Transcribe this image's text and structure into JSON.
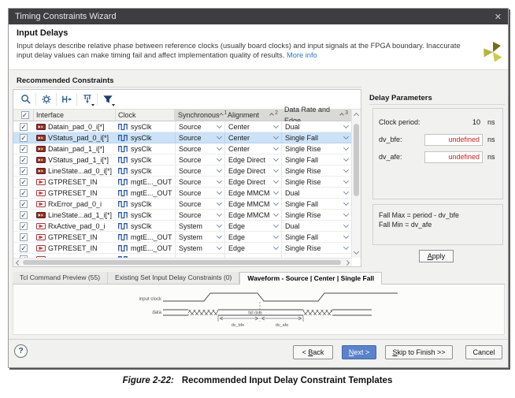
{
  "window": {
    "title": "Timing Constraints Wizard"
  },
  "glyphs": {
    "close": "✕",
    "check": "✓",
    "help": "?"
  },
  "header": {
    "title": "Input Delays",
    "description": "Input delays describe relative phase between reference clocks (usually board clocks) and input signals at the FPGA boundary. Inaccurate input delay values can make timing fail and affect implementation quality of results. ",
    "more_info": "More info"
  },
  "constraints": {
    "section_title": "Recommended Constraints",
    "toolbar_icons": [
      "search-icon",
      "settings-icon",
      "fit-to-selection-icon",
      "group-options-icon",
      "filter-icon"
    ],
    "table": {
      "columns": [
        {
          "label": "Interface"
        },
        {
          "label": "Clock"
        },
        {
          "label": "Synchronous",
          "sort": "1"
        },
        {
          "label": "Alignment",
          "sort": "2"
        },
        {
          "label": "Data Rate and Edge",
          "sort": "3"
        }
      ],
      "rows": [
        {
          "checked": true,
          "icon": "bus-port-icon",
          "interface": "Datain_pad_0_i[*]",
          "clock": "sysClk",
          "synchronous": "Source",
          "alignment": "Center",
          "data_rate": "Dual",
          "selected": false
        },
        {
          "checked": true,
          "icon": "bus-port-icon",
          "interface": "VStatus_pad_0_i[*]",
          "clock": "sysClk",
          "synchronous": "Source",
          "alignment": "Center",
          "data_rate": "Single Fall",
          "selected": true
        },
        {
          "checked": true,
          "icon": "bus-port-icon",
          "interface": "Datain_pad_1_i[*]",
          "clock": "sysClk",
          "synchronous": "Source",
          "alignment": "Center",
          "data_rate": "Single Rise",
          "selected": false
        },
        {
          "checked": true,
          "icon": "bus-port-icon",
          "interface": "VStatus_pad_1_i[*]",
          "clock": "sysClk",
          "synchronous": "Source",
          "alignment": "Edge Direct",
          "data_rate": "Single Fall",
          "selected": false
        },
        {
          "checked": true,
          "icon": "bus-port-icon",
          "interface": "LineState...ad_0_i[*]",
          "clock": "sysClk",
          "synchronous": "Source",
          "alignment": "Edge Direct",
          "data_rate": "Single Rise",
          "selected": false
        },
        {
          "checked": true,
          "icon": "input-port-icon",
          "interface": "GTPRESET_IN",
          "clock": "mgtE..._OUT",
          "synchronous": "Source",
          "alignment": "Edge Direct",
          "data_rate": "Single Rise",
          "selected": false
        },
        {
          "checked": true,
          "icon": "input-port-icon",
          "interface": "GTPRESET_IN",
          "clock": "mgtE..._OUT",
          "synchronous": "Source",
          "alignment": "Edge MMCM",
          "data_rate": "Dual",
          "selected": false
        },
        {
          "checked": true,
          "icon": "input-port-icon",
          "interface": "RxError_pad_0_i",
          "clock": "sysClk",
          "synchronous": "Source",
          "alignment": "Edge MMCM",
          "data_rate": "Single Fall",
          "selected": false
        },
        {
          "checked": true,
          "icon": "bus-port-icon",
          "interface": "LineState...ad_1_i[*]",
          "clock": "sysClk",
          "synchronous": "Source",
          "alignment": "Edge MMCM",
          "data_rate": "Single Rise",
          "selected": false
        },
        {
          "checked": true,
          "icon": "input-port-icon",
          "interface": "RxActive_pad_0_i",
          "clock": "sysClk",
          "synchronous": "System",
          "alignment": "Edge",
          "data_rate": "Dual",
          "selected": false
        },
        {
          "checked": true,
          "icon": "input-port-icon",
          "interface": "GTPRESET_IN",
          "clock": "mgtE..._OUT",
          "synchronous": "System",
          "alignment": "Edge",
          "data_rate": "Single Fall",
          "selected": false
        },
        {
          "checked": true,
          "icon": "input-port-icon",
          "interface": "GTPRESET_IN",
          "clock": "mgtE..._OUT",
          "synchronous": "System",
          "alignment": "Edge",
          "data_rate": "Single Rise",
          "selected": false
        }
      ],
      "partial_row": {
        "checked": true,
        "icon": "input-port-icon",
        "interface": "",
        "clock": "",
        "synchronous": "",
        "alignment": "",
        "data_rate": "",
        "selected": false
      }
    }
  },
  "delay_parameters": {
    "title": "Delay Parameters",
    "clock_period": {
      "label": "Clock period:",
      "value": "10",
      "unit": "ns"
    },
    "fields": [
      {
        "label": "dv_bfe:",
        "value": "undefined",
        "unit": "ns"
      },
      {
        "label": "dv_afe:",
        "value": "undefined",
        "unit": "ns"
      }
    ],
    "formula_line1": "Fall Max = period - dv_bfe",
    "formula_line2": "Fall Min = dv_afe",
    "apply": {
      "label": "Apply",
      "key": "A"
    }
  },
  "tabs": [
    {
      "label": "Tcl Command Preview (55)",
      "active": false
    },
    {
      "label": "Existing Set Input Delay Constraints (0)",
      "active": false
    },
    {
      "label": "Waveform - Source | Center | Single Fall",
      "active": true
    }
  ],
  "waveform": {
    "clock_label": "input clock",
    "data_label": "data",
    "center_label": "fall data",
    "left_span_label": "dv_bfe",
    "right_span_label": "dv_afe"
  },
  "footer": {
    "back": {
      "label": "< Back",
      "key": "B"
    },
    "next": {
      "label": "Next >",
      "key": "N"
    },
    "skip": {
      "label": "Skip to Finish >>",
      "key": "S"
    },
    "cancel": {
      "label": "Cancel",
      "key": ""
    }
  },
  "caption": {
    "figure_label": "Figure 2-22:",
    "figure_title": "Recommended Input Delay Constraint Templates"
  },
  "colors": {
    "titlebar": "#3e3e40",
    "accent_blue": "#5b83cc",
    "link_blue": "#2e74c9",
    "error_red": "#cc2222",
    "selected_row": "#cbe2f7"
  }
}
